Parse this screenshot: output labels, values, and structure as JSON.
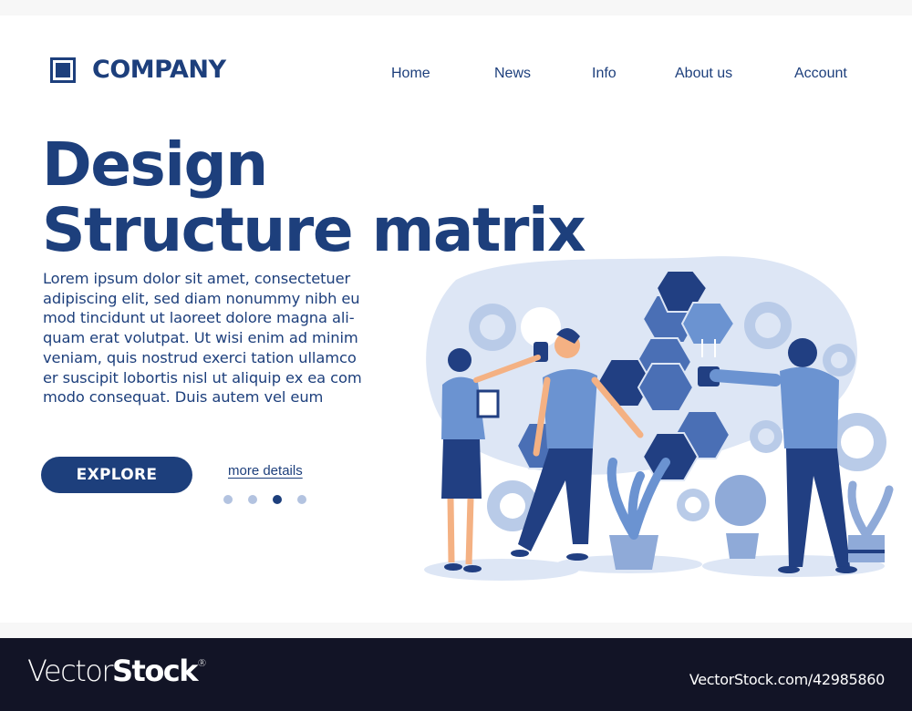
{
  "brand": {
    "name": "COMPANY",
    "icon": "square-logo-icon"
  },
  "nav": {
    "items": [
      {
        "label": "Home"
      },
      {
        "label": "News"
      },
      {
        "label": "Info"
      },
      {
        "label": "About us"
      },
      {
        "label": "Account"
      }
    ]
  },
  "hero": {
    "title_line1": "Design",
    "title_line2": "Structure matrix",
    "body": "Lorem ipsum dolor sit amet, consectetuer adipiscing elit, sed diam nonummy nibh eu mod tincidunt ut laoreet dolore magna ali- quam erat volutpat. Ut wisi enim ad minim veniam, quis nostrud exerci tation ullamco er suscipit lobortis nisl ut aliquip ex ea com modo consequat. Duis autem vel eum",
    "body_lines": [
      "Lorem ipsum dolor sit amet, consectetuer",
      "adipiscing elit, sed diam nonummy nibh eu",
      "mod tincidunt ut laoreet dolore magna ali-",
      "quam erat volutpat. Ut wisi enim ad minim",
      "veniam, quis nostrud exerci tation ullamco",
      "er suscipit lobortis nisl ut aliquip ex ea com",
      "modo consequat. Duis autem vel eum"
    ],
    "cta_label": "EXPLORE",
    "link_label": "more details",
    "pagination": {
      "total": 4,
      "active_index": 2
    }
  },
  "illustration": {
    "description": "Three people assembling blue hexagon tiles with light bulbs, gears and potted plants",
    "colors": {
      "dark": "#213f82",
      "mid": "#4a6fb5",
      "light": "#6b93d1",
      "pale": "#dde6f5",
      "skin": "#f4b183"
    }
  },
  "footer": {
    "logo_light": "Vector",
    "logo_bold": "Stock",
    "registered": "®",
    "image_id": "VectorStock.com/42985860"
  },
  "colors": {
    "primary": "#1d3f7c",
    "dot_inactive": "#b3c3e0",
    "footer_bg": "#121426"
  }
}
